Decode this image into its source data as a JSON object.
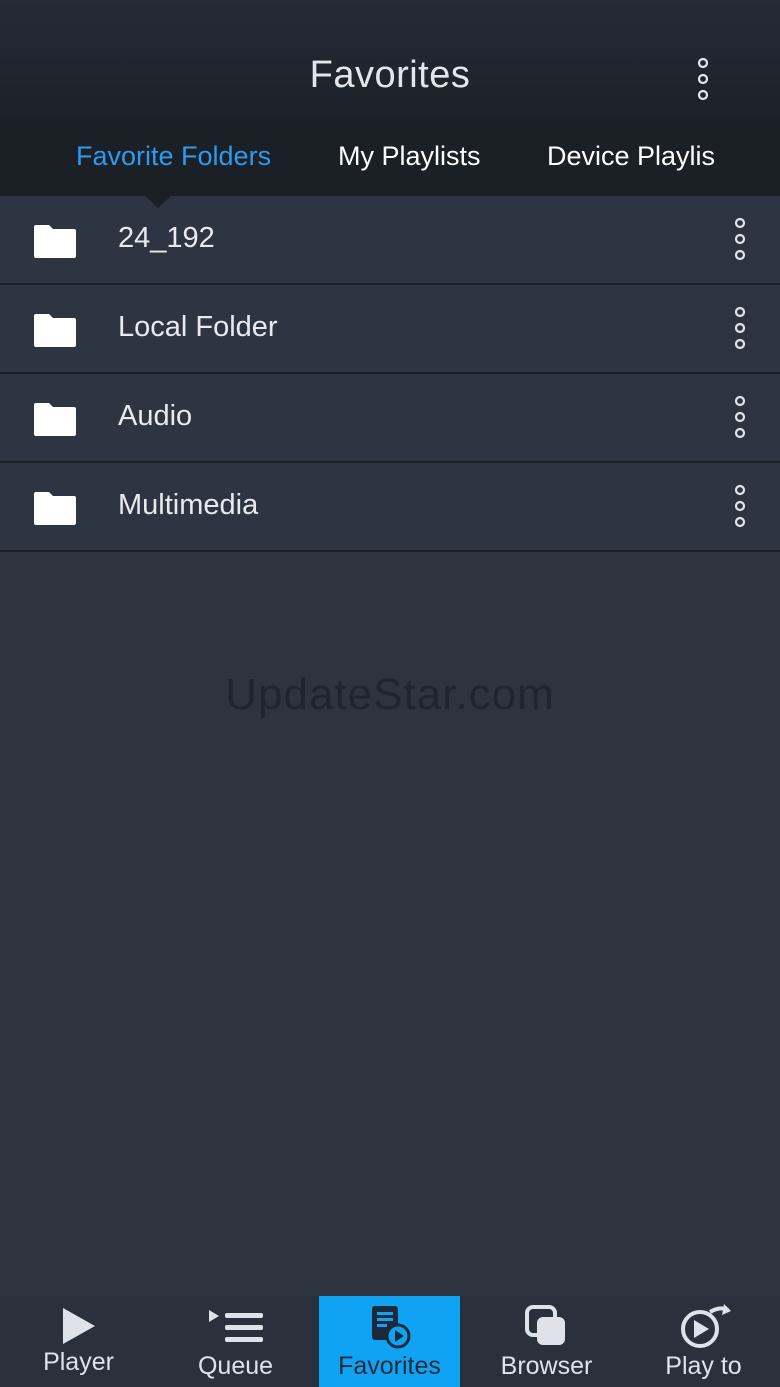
{
  "header": {
    "title": "Favorites",
    "more_icon": "vertical-dots-icon"
  },
  "tabs": [
    {
      "label": "Favorite Folders",
      "active": true
    },
    {
      "label": "My Playlists",
      "active": false
    },
    {
      "label": "Device Playlis",
      "active": false
    }
  ],
  "folders": [
    {
      "label": "24_192",
      "icon": "folder-icon"
    },
    {
      "label": "Local Folder",
      "icon": "folder-icon"
    },
    {
      "label": "Audio",
      "icon": "folder-icon"
    },
    {
      "label": "Multimedia",
      "icon": "folder-icon"
    }
  ],
  "watermark": "UpdateStar.com",
  "tabbar": [
    {
      "label": "Player",
      "icon": "play-icon",
      "active": false
    },
    {
      "label": "Queue",
      "icon": "queue-icon",
      "active": false
    },
    {
      "label": "Favorites",
      "icon": "favorites-icon",
      "active": true
    },
    {
      "label": "Browser",
      "icon": "browser-icon",
      "active": false
    },
    {
      "label": "Play to",
      "icon": "play-to-icon",
      "active": false
    }
  ],
  "colors": {
    "accent": "#2c9bef",
    "active_tab_bg": "#10a3f3",
    "background": "#2d3440"
  }
}
